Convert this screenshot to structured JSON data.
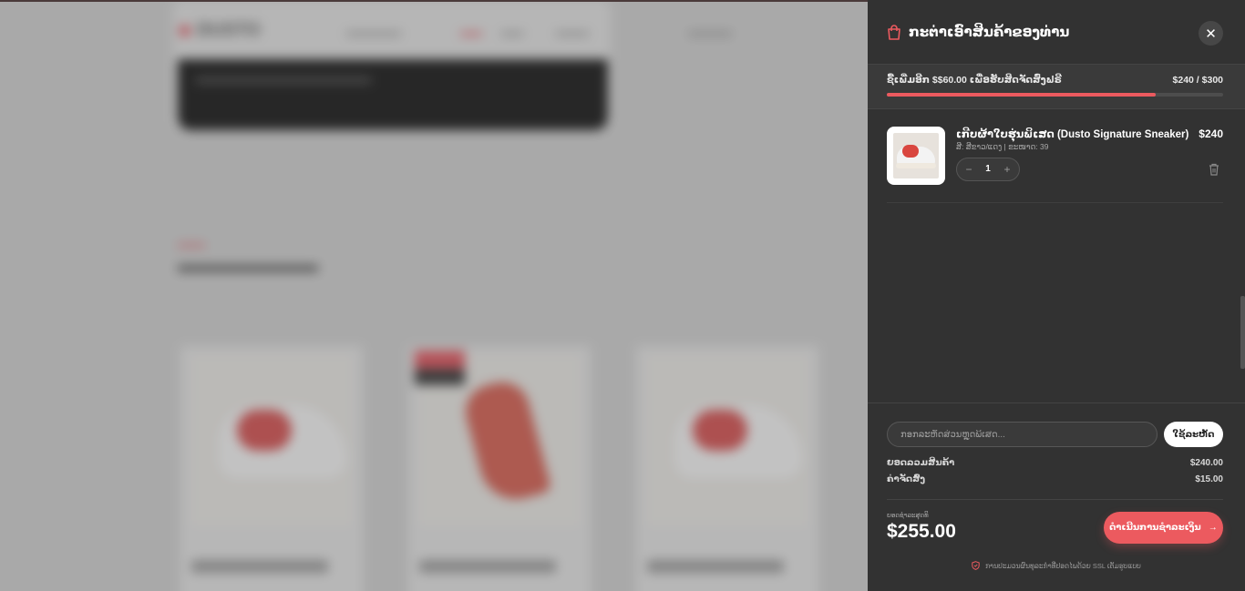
{
  "background_page": {
    "logo": "DUSTO",
    "section_heading": ""
  },
  "cart": {
    "title": "ກະຕ່າເອົາສິນຄ້າຂອງທ່ານ",
    "close_icon": "close-icon",
    "free_shipping": {
      "message": "ຊື້ເພີ່ມອີກ $$60.00 ເພື່ອຮັບສິດຈັດສົ່ງຟຣີ",
      "progress_text": "$240 / $300",
      "progress_fraction": 0.8
    },
    "items": [
      {
        "name": "ເກີບຜ້າໃບຮຸ່ນພິເສດ (Dusto Signature Sneaker)",
        "meta": "ສີ: ສີຂາວ/ແດງ | ຂະໜາດ: 39",
        "price": "$240",
        "quantity": "1",
        "minus": "−",
        "plus": "+"
      }
    ],
    "promo": {
      "placeholder": "ກອກລະຫັດສ່ວນຫຼຸດພິເສດ...",
      "apply_label": "ໃຊ້ລະຫັດ"
    },
    "summary": {
      "subtotal_label": "ຍອດລວມສິນຄ້າ",
      "subtotal_value": "$240.00",
      "shipping_label": "ຄ່າຈັດສົ່ງ",
      "shipping_value": "$15.00"
    },
    "total": {
      "label": "ຍອດຊຳລະສຸດທິ",
      "value": "$255.00"
    },
    "checkout_label": "ດຳເນີນການຊຳລະເງິນ",
    "secure_note": "ການປະມວນຜົນທຸລະກຳທີ່ປອດໄພດ້ວຍ SSL ເຕັມຮູບແບບ",
    "colors": {
      "accent": "#ec5a5f",
      "drawer_bg": "#323232"
    }
  }
}
